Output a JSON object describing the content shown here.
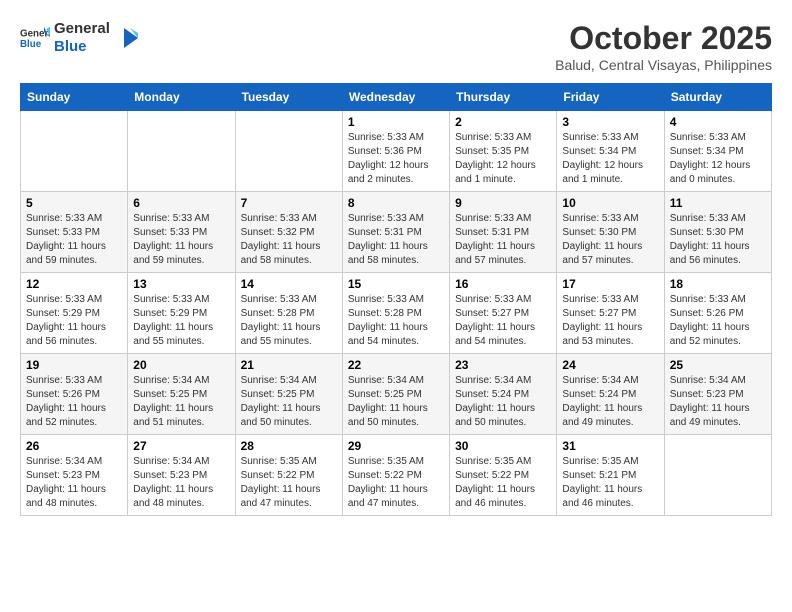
{
  "header": {
    "logo_general": "General",
    "logo_blue": "Blue",
    "month_title": "October 2025",
    "location": "Balud, Central Visayas, Philippines"
  },
  "weekdays": [
    "Sunday",
    "Monday",
    "Tuesday",
    "Wednesday",
    "Thursday",
    "Friday",
    "Saturday"
  ],
  "weeks": [
    [
      {
        "day": "",
        "info": ""
      },
      {
        "day": "",
        "info": ""
      },
      {
        "day": "",
        "info": ""
      },
      {
        "day": "1",
        "info": "Sunrise: 5:33 AM\nSunset: 5:36 PM\nDaylight: 12 hours\nand 2 minutes."
      },
      {
        "day": "2",
        "info": "Sunrise: 5:33 AM\nSunset: 5:35 PM\nDaylight: 12 hours\nand 1 minute."
      },
      {
        "day": "3",
        "info": "Sunrise: 5:33 AM\nSunset: 5:34 PM\nDaylight: 12 hours\nand 1 minute."
      },
      {
        "day": "4",
        "info": "Sunrise: 5:33 AM\nSunset: 5:34 PM\nDaylight: 12 hours\nand 0 minutes."
      }
    ],
    [
      {
        "day": "5",
        "info": "Sunrise: 5:33 AM\nSunset: 5:33 PM\nDaylight: 11 hours\nand 59 minutes."
      },
      {
        "day": "6",
        "info": "Sunrise: 5:33 AM\nSunset: 5:33 PM\nDaylight: 11 hours\nand 59 minutes."
      },
      {
        "day": "7",
        "info": "Sunrise: 5:33 AM\nSunset: 5:32 PM\nDaylight: 11 hours\nand 58 minutes."
      },
      {
        "day": "8",
        "info": "Sunrise: 5:33 AM\nSunset: 5:31 PM\nDaylight: 11 hours\nand 58 minutes."
      },
      {
        "day": "9",
        "info": "Sunrise: 5:33 AM\nSunset: 5:31 PM\nDaylight: 11 hours\nand 57 minutes."
      },
      {
        "day": "10",
        "info": "Sunrise: 5:33 AM\nSunset: 5:30 PM\nDaylight: 11 hours\nand 57 minutes."
      },
      {
        "day": "11",
        "info": "Sunrise: 5:33 AM\nSunset: 5:30 PM\nDaylight: 11 hours\nand 56 minutes."
      }
    ],
    [
      {
        "day": "12",
        "info": "Sunrise: 5:33 AM\nSunset: 5:29 PM\nDaylight: 11 hours\nand 56 minutes."
      },
      {
        "day": "13",
        "info": "Sunrise: 5:33 AM\nSunset: 5:29 PM\nDaylight: 11 hours\nand 55 minutes."
      },
      {
        "day": "14",
        "info": "Sunrise: 5:33 AM\nSunset: 5:28 PM\nDaylight: 11 hours\nand 55 minutes."
      },
      {
        "day": "15",
        "info": "Sunrise: 5:33 AM\nSunset: 5:28 PM\nDaylight: 11 hours\nand 54 minutes."
      },
      {
        "day": "16",
        "info": "Sunrise: 5:33 AM\nSunset: 5:27 PM\nDaylight: 11 hours\nand 54 minutes."
      },
      {
        "day": "17",
        "info": "Sunrise: 5:33 AM\nSunset: 5:27 PM\nDaylight: 11 hours\nand 53 minutes."
      },
      {
        "day": "18",
        "info": "Sunrise: 5:33 AM\nSunset: 5:26 PM\nDaylight: 11 hours\nand 52 minutes."
      }
    ],
    [
      {
        "day": "19",
        "info": "Sunrise: 5:33 AM\nSunset: 5:26 PM\nDaylight: 11 hours\nand 52 minutes."
      },
      {
        "day": "20",
        "info": "Sunrise: 5:34 AM\nSunset: 5:25 PM\nDaylight: 11 hours\nand 51 minutes."
      },
      {
        "day": "21",
        "info": "Sunrise: 5:34 AM\nSunset: 5:25 PM\nDaylight: 11 hours\nand 50 minutes."
      },
      {
        "day": "22",
        "info": "Sunrise: 5:34 AM\nSunset: 5:25 PM\nDaylight: 11 hours\nand 50 minutes."
      },
      {
        "day": "23",
        "info": "Sunrise: 5:34 AM\nSunset: 5:24 PM\nDaylight: 11 hours\nand 50 minutes."
      },
      {
        "day": "24",
        "info": "Sunrise: 5:34 AM\nSunset: 5:24 PM\nDaylight: 11 hours\nand 49 minutes."
      },
      {
        "day": "25",
        "info": "Sunrise: 5:34 AM\nSunset: 5:23 PM\nDaylight: 11 hours\nand 49 minutes."
      }
    ],
    [
      {
        "day": "26",
        "info": "Sunrise: 5:34 AM\nSunset: 5:23 PM\nDaylight: 11 hours\nand 48 minutes."
      },
      {
        "day": "27",
        "info": "Sunrise: 5:34 AM\nSunset: 5:23 PM\nDaylight: 11 hours\nand 48 minutes."
      },
      {
        "day": "28",
        "info": "Sunrise: 5:35 AM\nSunset: 5:22 PM\nDaylight: 11 hours\nand 47 minutes."
      },
      {
        "day": "29",
        "info": "Sunrise: 5:35 AM\nSunset: 5:22 PM\nDaylight: 11 hours\nand 47 minutes."
      },
      {
        "day": "30",
        "info": "Sunrise: 5:35 AM\nSunset: 5:22 PM\nDaylight: 11 hours\nand 46 minutes."
      },
      {
        "day": "31",
        "info": "Sunrise: 5:35 AM\nSunset: 5:21 PM\nDaylight: 11 hours\nand 46 minutes."
      },
      {
        "day": "",
        "info": ""
      }
    ]
  ]
}
